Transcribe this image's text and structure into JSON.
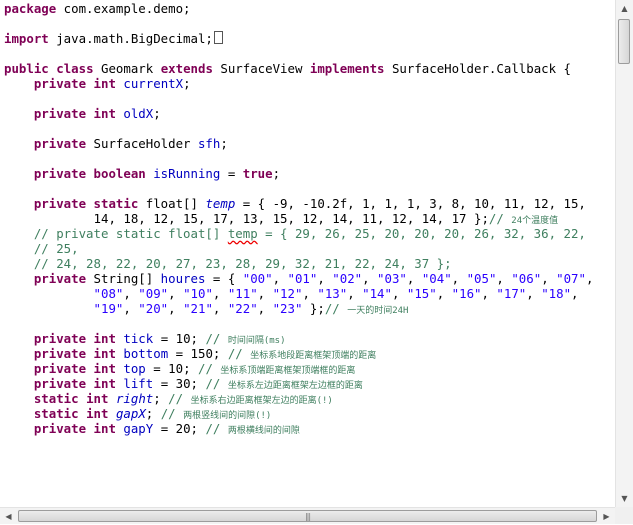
{
  "code": {
    "l1_kw": "package",
    "l1_rest": " com.example.demo;",
    "l2_kw": "import",
    "l2_rest": " java.math.BigDecimal;",
    "l3_kw1": "public",
    "l3_kw2": "class",
    "l3_name": " Geomark ",
    "l3_kw3": "extends",
    "l3_mid": " SurfaceView ",
    "l3_kw4": "implements",
    "l3_end": " SurfaceHolder.Callback {",
    "private": "private",
    "static": "static",
    "int": "int",
    "boolean": "boolean",
    "true": "true",
    "l4_field": "currentX",
    "l5_field": "oldX",
    "l6_type": " SurfaceHolder ",
    "l6_field": "sfh",
    "l7_field": "isRunning",
    "l7_eq": " = ",
    "l8_type": " float[] ",
    "l8_field": "temp",
    "l8_vals": " = { -9, -10.2f, 1, 1, 1, 3, 8, 10, 11, 12, 15,",
    "l9_vals": "14, 18, 12, 15, 17, 13, 15, 12, 14, 11, 12, 14, 17 };",
    "l9_cm": "// ",
    "l9_cm_cjk": "24个温度值",
    "l10_a": "// private static float[] ",
    "l10_b": "temp",
    "l10_c": " = { 29, 26, 25, 20, 20, 20, 26, 32, 36, 22,",
    "l11": "// 25,",
    "l12": "// 24, 28, 22, 20, 27, 23, 28, 29, 32, 21, 22, 24, 37 };",
    "l13_type": " String[] ",
    "l13_field": "houres",
    "l13_eq": " = { ",
    "hours": [
      "\"00\"",
      "\"01\"",
      "\"02\"",
      "\"03\"",
      "\"04\"",
      "\"05\"",
      "\"06\"",
      "\"07\"",
      "\"08\"",
      "\"09\"",
      "\"10\"",
      "\"11\"",
      "\"12\"",
      "\"13\"",
      "\"14\"",
      "\"15\"",
      "\"16\"",
      "\"17\"",
      "\"18\"",
      "\"19\"",
      "\"20\"",
      "\"21\"",
      "\"22\"",
      "\"23\""
    ],
    "l15_end": " };",
    "l15_cm": "// ",
    "l15_cm_cjk": "一天的时间24H",
    "f_tick": "tick",
    "v_tick": " = 10; ",
    "c_tick": "// ",
    "c_tick_cjk": "时间间隔(ms)",
    "f_bottom": "bottom",
    "v_bottom": " = 150; ",
    "c_bottom": "// ",
    "c_bottom_cjk": "坐标系地段距离框架顶端的距离",
    "f_top": "top",
    "v_top": " = 10; ",
    "c_top": "// ",
    "c_top_cjk": "坐标系顶端距离框架顶端框的距离",
    "f_lift": "lift",
    "v_lift": " = 30; ",
    "c_lift": "// ",
    "c_lift_cjk": "坐标系左边距离框架左边框的距离",
    "f_right": "right",
    "v_right": "; ",
    "c_right": "// ",
    "c_right_cjk": "坐标系右边距离框架左边的距离(!)",
    "f_gapX": "gapX",
    "v_gapX": "; ",
    "c_gapX": "// ",
    "c_gapX_cjk": "两根竖线间的间隙(!)",
    "f_gapY": "gapY",
    "v_gapY": " = 20; ",
    "c_gapY": "// ",
    "c_gapY_cjk": "两根横线间的间隙"
  },
  "scrollbars": {
    "up_arrow": "▲",
    "down_arrow": "▼",
    "left_arrow": "◀",
    "right_arrow": "▶",
    "grip": "|||"
  }
}
